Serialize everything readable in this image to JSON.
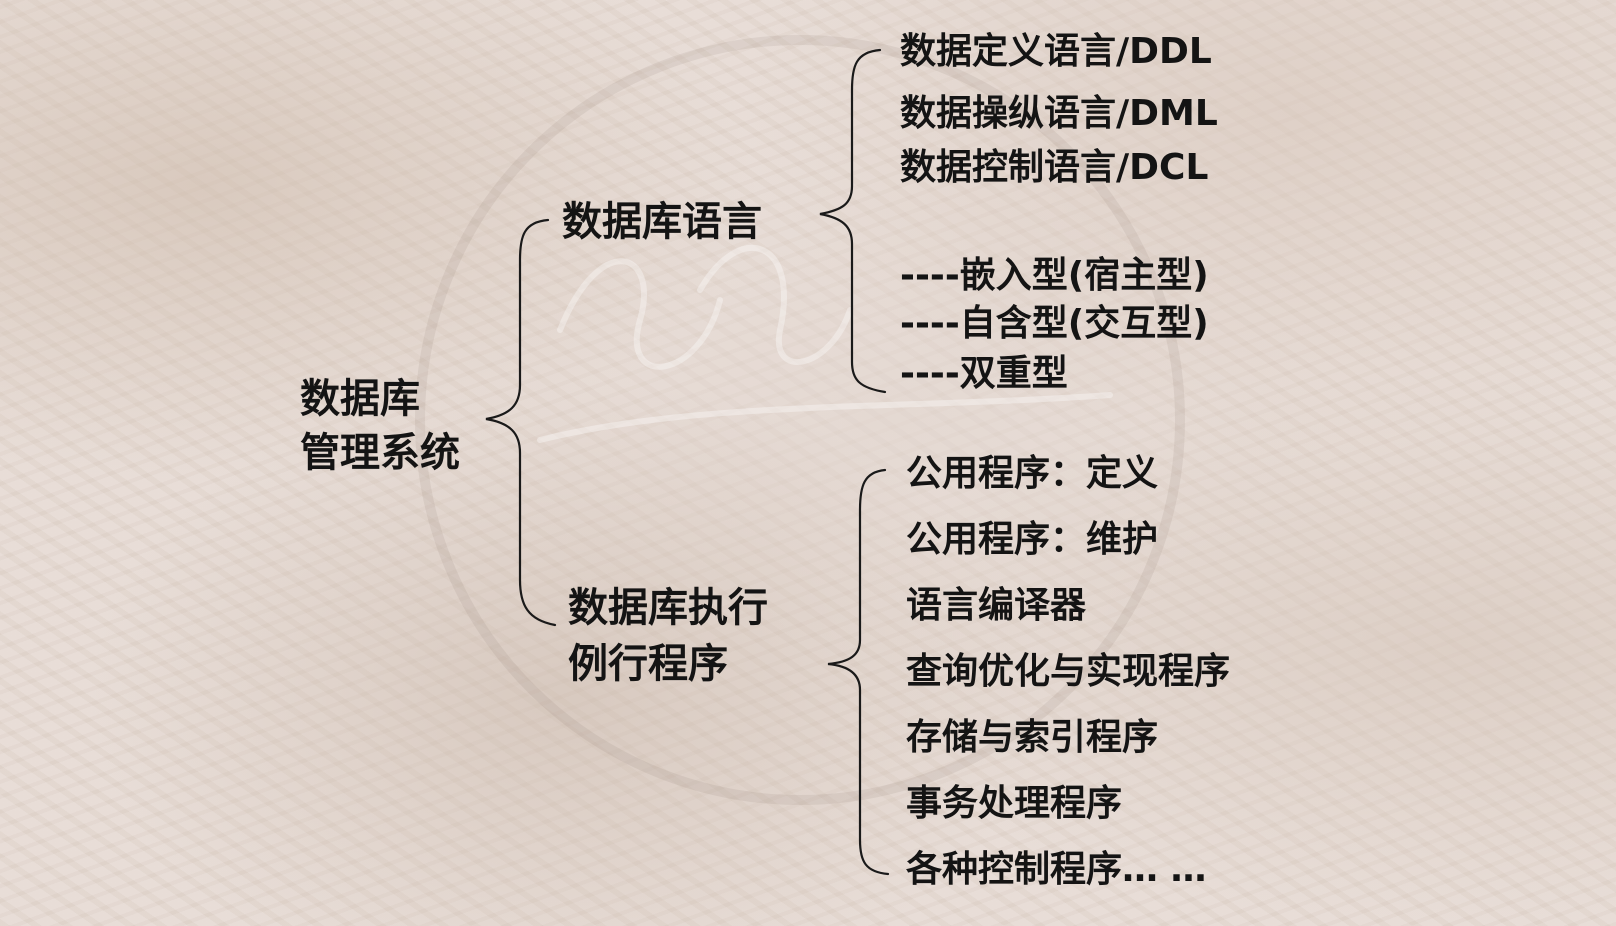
{
  "root": {
    "lines": [
      "数据库",
      "管理系统"
    ]
  },
  "branches": {
    "language": {
      "label": "数据库语言",
      "leaves": [
        "数据定义语言/DDL",
        "数据操纵语言/DML",
        "数据控制语言/DCL",
        "----嵌入型(宿主型)",
        "----自含型(交互型)",
        "----双重型"
      ]
    },
    "routines": {
      "lines": [
        "数据库执行",
        "例行程序"
      ],
      "leaves": [
        "公用程序：定义",
        "公用程序：维护",
        "语言编译器",
        "查询优化与实现程序",
        "存储与索引程序",
        "事务处理程序",
        "各种控制程序… …"
      ]
    }
  },
  "colors": {
    "text": "#141414",
    "bracket": "#1a1a1a",
    "background": "#e7dcd6"
  }
}
